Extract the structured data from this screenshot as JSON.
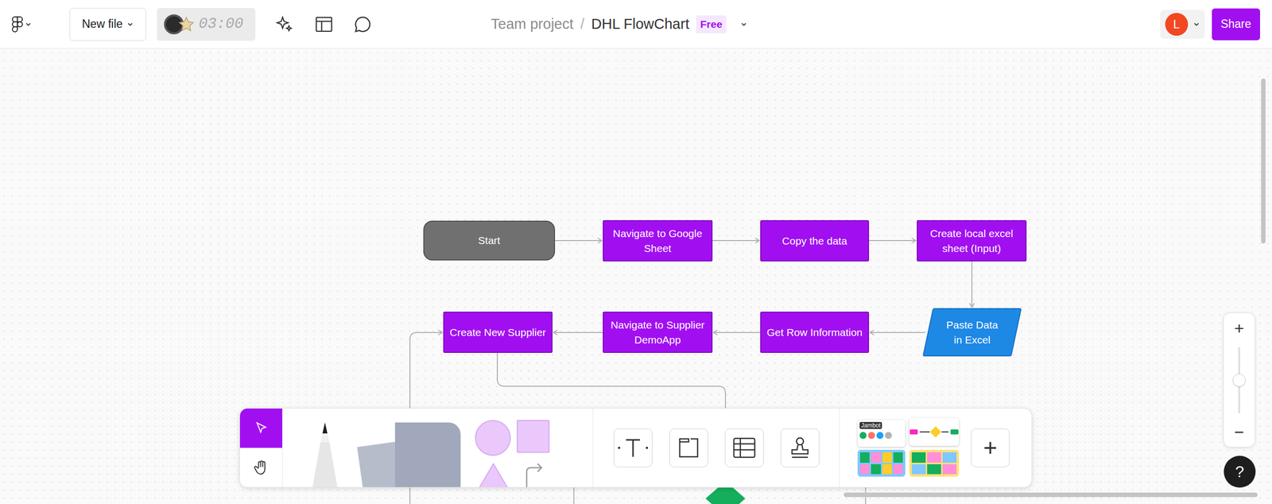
{
  "topbar": {
    "new_file": "New file",
    "timer": "03:00",
    "breadcrumb": {
      "project": "Team project",
      "separator": "/",
      "file": "DHL FlowChart",
      "plan": "Free"
    },
    "avatar": "L",
    "share": "Share"
  },
  "nodes": [
    {
      "label": "Start",
      "kind": "terminal"
    },
    {
      "label": "Navigate to Google Sheet",
      "kind": "process"
    },
    {
      "label": "Copy the data",
      "kind": "process"
    },
    {
      "label": "Create local excel sheet (Input)",
      "kind": "process"
    },
    {
      "label": "Paste Data in Excel",
      "kind": "data"
    },
    {
      "label": "Get Row Information",
      "kind": "process"
    },
    {
      "label": "Navigate to Supplier DemoApp",
      "kind": "process"
    },
    {
      "label": "Create New Supplier",
      "kind": "process"
    }
  ],
  "toolbar": {
    "modes": [
      {
        "kind": "select",
        "selected": true
      },
      {
        "kind": "hand",
        "selected": false
      }
    ],
    "widget_label": "Jambot",
    "more": "+"
  },
  "zoom": {
    "in": "+",
    "out": "−",
    "level": 0.5
  },
  "help": "?"
}
